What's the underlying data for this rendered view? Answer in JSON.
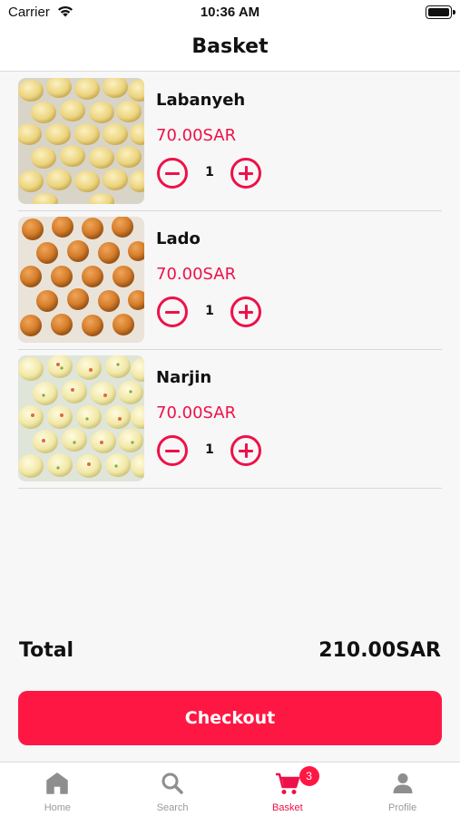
{
  "status_bar": {
    "carrier": "Carrier",
    "time": "10:36 AM"
  },
  "nav": {
    "title": "Basket"
  },
  "items": [
    {
      "name": "Labanyeh",
      "price": "70.00SAR",
      "quantity": "1"
    },
    {
      "name": "Lado",
      "price": "70.00SAR",
      "quantity": "1"
    },
    {
      "name": "Narjin",
      "price": "70.00SAR",
      "quantity": "1"
    }
  ],
  "summary": {
    "total_label": "Total",
    "total_value": "210.00SAR"
  },
  "checkout": {
    "label": "Checkout"
  },
  "tab_bar": {
    "tabs": [
      {
        "label": "Home",
        "icon": "home-icon"
      },
      {
        "label": "Search",
        "icon": "search-icon"
      },
      {
        "label": "Basket",
        "icon": "cart-icon",
        "badge": "3",
        "active": true
      },
      {
        "label": "Profile",
        "icon": "person-icon"
      }
    ]
  },
  "colors": {
    "accent": "#ee1149",
    "button": "#ff1744",
    "inactive_tab": "#9a9a9a"
  }
}
